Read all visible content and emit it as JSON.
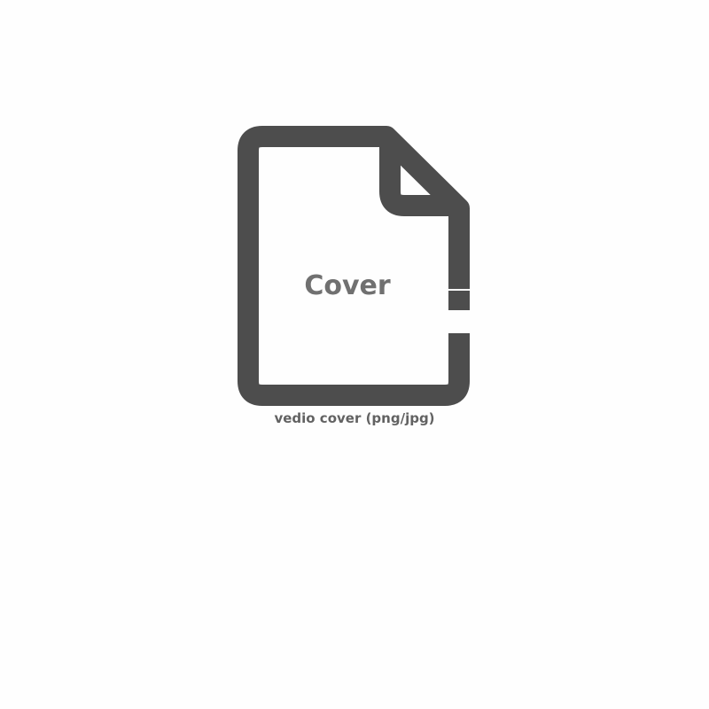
{
  "icon": {
    "name": "document-icon",
    "color": "#4d4d4d",
    "label": "Cover"
  },
  "caption": "vedio cover (png/jpg)"
}
